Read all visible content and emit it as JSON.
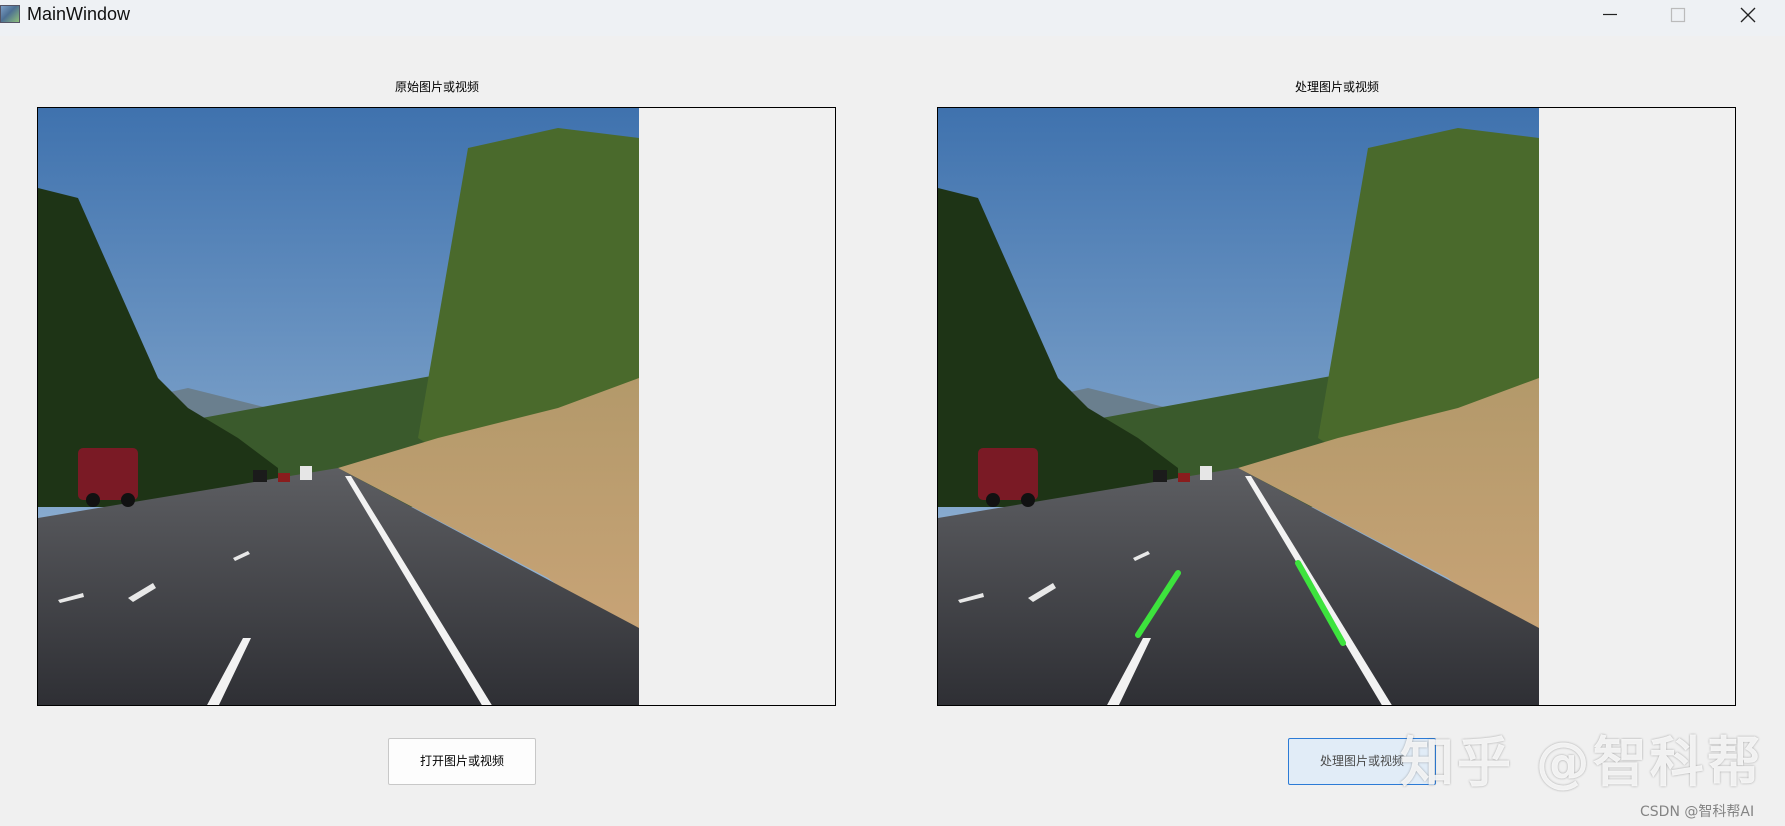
{
  "window": {
    "title": "MainWindow",
    "controls": [
      "minimize-icon",
      "maximize-icon",
      "close-icon"
    ]
  },
  "panels": {
    "left": {
      "caption": "原始图片或视频"
    },
    "right": {
      "caption": "处理图片或视频"
    }
  },
  "buttons": {
    "open_label": "打开图片或视频",
    "process_label": "处理图片或视频"
  },
  "overlay": {
    "watermark": "知乎 @智科帮",
    "credit": "CSDN @智科帮AI"
  },
  "colors": {
    "lane_highlight": "#3de33d",
    "process_button_border": "#2c7bd6"
  }
}
